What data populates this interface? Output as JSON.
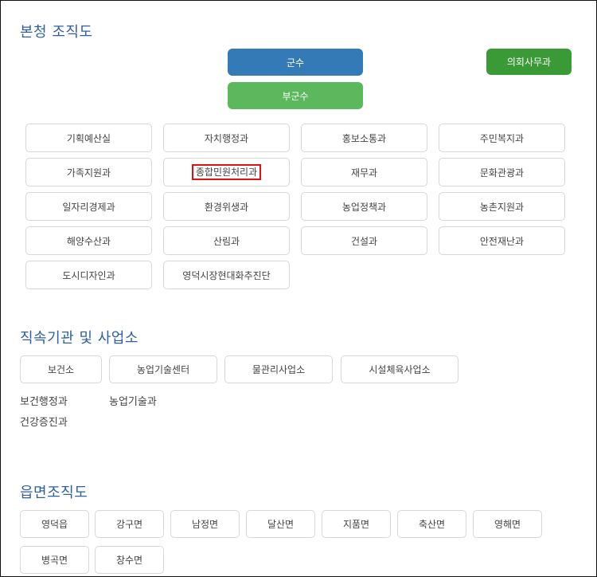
{
  "main_title": "본청 조직도",
  "top": {
    "governor": "군수",
    "deputy": "부군수",
    "council": "의회사무과"
  },
  "departments": [
    "기획예산실",
    "자치행정과",
    "홍보소통과",
    "주민복지과",
    "가족지원과",
    "종합민원처리과",
    "재무과",
    "문화관광과",
    "일자리경제과",
    "환경위생과",
    "농업정책과",
    "농촌지원과",
    "해양수산과",
    "산림과",
    "건설과",
    "안전재난과",
    "도시디자인과",
    "영덕시장현대화추진단"
  ],
  "highlighted_department": "종합민원처리과",
  "colors": {
    "title": "#2f5f9f",
    "governor_bg": "#337ab7",
    "deputy_bg": "#5cb85c",
    "council_bg": "#3a9a36",
    "highlight_border": "#e01111"
  },
  "affiliated": {
    "title": "직속기관 및 사업소",
    "buttons": [
      "보건소",
      "농업기술센터",
      "물관리사업소",
      "시설체육사업소"
    ],
    "sub_items": [
      "보건행정과",
      "농업기술과",
      "건강증진과"
    ]
  },
  "towns": {
    "title": "읍면조직도",
    "buttons": [
      "영덕읍",
      "강구면",
      "남정면",
      "달산면",
      "지품면",
      "축산면",
      "영해면",
      "병곡면",
      "창수면"
    ]
  }
}
